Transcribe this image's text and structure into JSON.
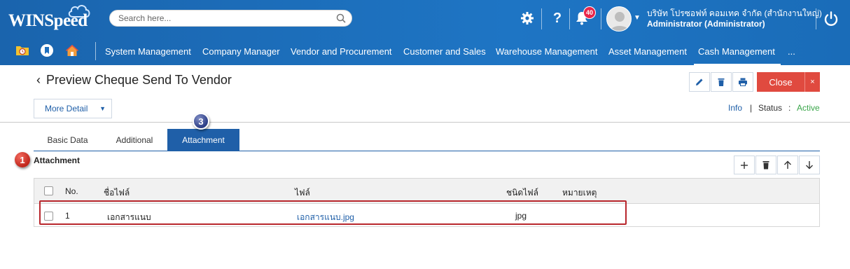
{
  "app": {
    "logo": "WINSpeed",
    "search_placeholder": "Search here...",
    "notification_count": "40",
    "company": "บริษัท โปรซอฟท์ คอมเทค จำกัด (สำนักงานใหญ่)",
    "role": "Administrator (Administrator)"
  },
  "menu": [
    {
      "label": "System Management"
    },
    {
      "label": "Company Manager"
    },
    {
      "label": "Vendor and Procurement"
    },
    {
      "label": "Customer and Sales"
    },
    {
      "label": "Warehouse Management"
    },
    {
      "label": "Asset Management"
    },
    {
      "label": "Cash Management",
      "active": true
    },
    {
      "label": "..."
    }
  ],
  "page": {
    "title": "Preview Cheque Send To Vendor",
    "close_label": "Close",
    "close_x": "×",
    "more_detail": "More Detail",
    "info": "Info",
    "pipe": "|",
    "status_label": "Status",
    "status_colon": ":",
    "status_value": "Active"
  },
  "tabs": [
    {
      "label": "Basic Data"
    },
    {
      "label": "Additional"
    },
    {
      "label": "Attachment",
      "active": true
    }
  ],
  "markers": {
    "section": "1",
    "tab": "3"
  },
  "section": {
    "title": "Attachment"
  },
  "table": {
    "headers": [
      "No.",
      "ชื่อไฟล์",
      "ไฟล์",
      "ชนิดไฟล์",
      "หมายเหตุ"
    ],
    "rows": [
      {
        "no": "1",
        "name": "เอกสารแนบ",
        "file": "เอกสารแนบ.jpg",
        "type": "jpg",
        "note": ""
      }
    ]
  },
  "colors": {
    "topbar": "#1e6fbe",
    "active_tab": "#1f5fa8",
    "close_button": "#e04a3f",
    "status_active": "#3aa64a",
    "highlight_border": "#b8262c"
  }
}
